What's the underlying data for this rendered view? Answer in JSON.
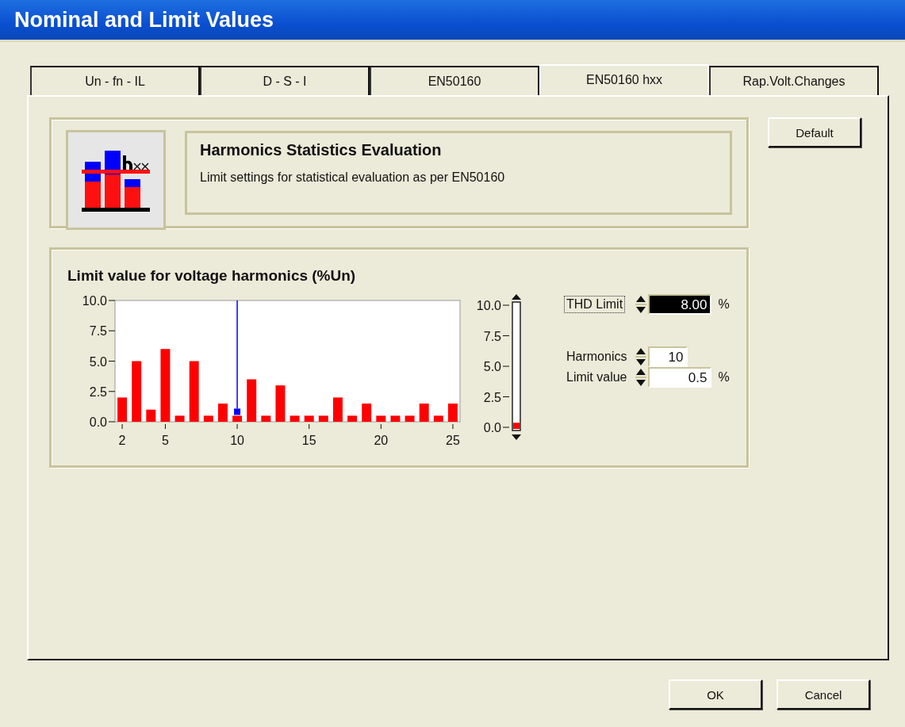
{
  "window": {
    "title": "Nominal and Limit Values"
  },
  "tabs": [
    {
      "label": "Un - fn - IL",
      "selected": false
    },
    {
      "label": "D - S - I",
      "selected": false
    },
    {
      "label": "EN50160",
      "selected": false
    },
    {
      "label": "EN50160 hxx",
      "selected": true
    },
    {
      "label": "Rap.Volt.Changes",
      "selected": false
    }
  ],
  "header": {
    "title": "Harmonics Statistics Evaluation",
    "description": "Limit settings for statistical evaluation as per EN50160"
  },
  "default_button": "Default",
  "chart_panel": {
    "title": "Limit value for voltage harmonics (%Un)",
    "chart_data": {
      "type": "bar",
      "x": [
        2,
        3,
        4,
        5,
        6,
        7,
        8,
        9,
        10,
        11,
        12,
        13,
        14,
        15,
        16,
        17,
        18,
        19,
        20,
        21,
        22,
        23,
        24,
        25
      ],
      "series": [
        {
          "color": "#ff0000",
          "values": [
            2.0,
            5.0,
            1.0,
            6.0,
            0.5,
            5.0,
            0.5,
            1.5,
            0.5,
            3.5,
            0.5,
            3.0,
            0.5,
            0.5,
            0.5,
            2.0,
            0.5,
            1.5,
            0.5,
            0.5,
            0.5,
            1.5,
            0.5,
            1.5
          ]
        }
      ],
      "ylim": [
        0,
        10
      ],
      "xlim": [
        1.5,
        25.5
      ],
      "xticks": [
        2,
        5,
        10,
        15,
        20,
        25
      ],
      "yticks": [
        {
          "value": 0,
          "label": "0.0"
        },
        {
          "value": 2.5,
          "label": "2.5"
        },
        {
          "value": 5,
          "label": "5.0"
        },
        {
          "value": 7.5,
          "label": "7.5"
        },
        {
          "value": 10,
          "label": "10.0"
        }
      ],
      "ref_lines": [
        {
          "axis": "x",
          "value": 10,
          "color": "#0000ff"
        }
      ]
    },
    "slider": {
      "level": 0.05,
      "ticks": [
        "10.0",
        "7.5",
        "5.0",
        "2.5",
        "0.0"
      ]
    },
    "fields": [
      {
        "label": "THD Limit",
        "value": "8.00",
        "unit": "%",
        "focused": true
      },
      {
        "label": "Harmonics",
        "value": "10",
        "focused": false
      },
      {
        "label": "Limit value",
        "value": "0.5",
        "unit": "%",
        "focused": false
      }
    ]
  },
  "buttons": [
    {
      "label": "OK"
    },
    {
      "label": "Cancel"
    }
  ]
}
